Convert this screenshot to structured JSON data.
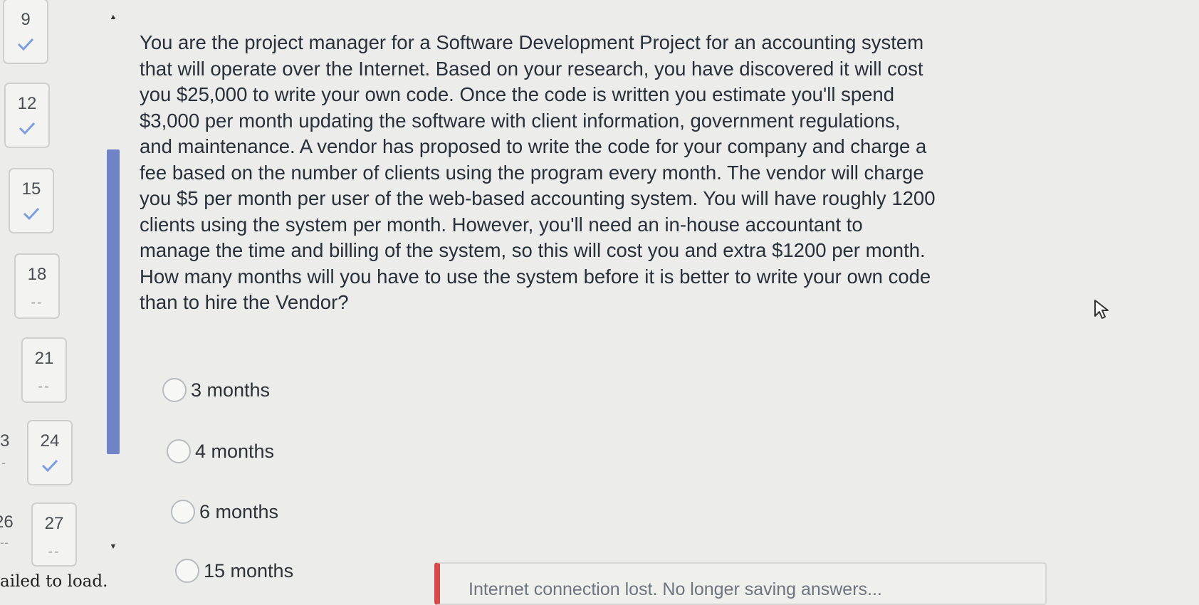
{
  "navigator": {
    "tiles": [
      {
        "number": "9",
        "status": "answered"
      },
      {
        "number": "12",
        "status": "answered"
      },
      {
        "number": "15",
        "status": "answered"
      },
      {
        "number": "18",
        "status": "unanswered",
        "mark": "--"
      },
      {
        "number": "21",
        "status": "unanswered",
        "mark": "--"
      },
      {
        "number": "24",
        "status": "answered"
      },
      {
        "number": "27",
        "status": "unanswered",
        "mark": "--"
      }
    ],
    "partial_left": [
      {
        "number": "3",
        "mark": "-"
      },
      {
        "number": "26",
        "mark": "--"
      }
    ]
  },
  "question": {
    "text": "You are the project manager for a Software Development Project for an accounting system that will operate over the Internet. Based on your research, you have discovered it will cost you $25,000 to write your own code. Once the code is written you estimate you'll spend $3,000 per month updating the software with client information, government regulations, and maintenance. A vendor has proposed to write the code for your company and charge a fee based on the number of clients using the program every month. The vendor will charge you $5 per month per user of the web-based accounting system. You will have roughly 1200 clients using the system per month. However, you'll need an in-house accountant to manage the time and billing of the system, so this will cost you and extra $1200 per month. How many months will you have to use the system before it is better to write your own code than to hire the Vendor?",
    "options": [
      "3 months",
      "4 months",
      "6 months",
      "15 months"
    ]
  },
  "status": {
    "failed_text": "ailed to load.",
    "banner_text": "Internet connection lost. No longer saving answers..."
  },
  "colors": {
    "accent": "#6e84c6",
    "check": "#7a9ee0",
    "alert": "#d64a4a"
  },
  "icons": [
    "check-icon",
    "scroll-up-arrow-icon",
    "scroll-down-arrow-icon",
    "mouse-pointer-icon"
  ]
}
